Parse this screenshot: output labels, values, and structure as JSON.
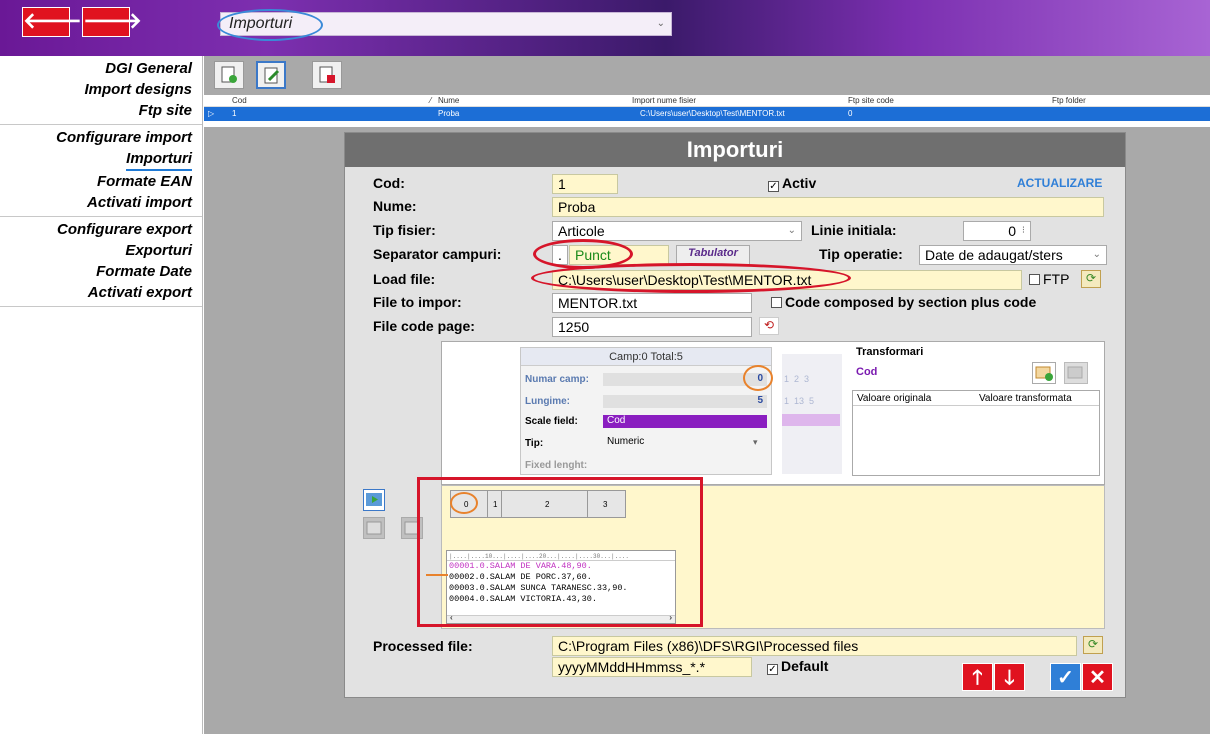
{
  "nav": {
    "back_glyph": "🡐",
    "forward_glyph": "🡒",
    "module_select_value": "Importuri"
  },
  "menu": {
    "groups": [
      [
        "DGI General",
        "Import designs",
        "Ftp site"
      ],
      [
        "Configurare import",
        "Importuri",
        "Formate EAN",
        "Activati import"
      ],
      [
        "Configurare export",
        "Exporturi",
        "Formate Date",
        "Activati export"
      ]
    ]
  },
  "grid": {
    "headers": [
      "Cod",
      "Nume",
      "Import nume fisier",
      "Ftp site code",
      "Ftp folder"
    ],
    "row": {
      "marker": "▷",
      "cod": "1",
      "nume": "Proba",
      "import_file": "C:\\Users\\user\\Desktop\\Test\\MENTOR.txt",
      "ftp_site_code": "0"
    }
  },
  "dialog": {
    "title": "Importuri",
    "cod_label": "Cod:",
    "cod_value": "1",
    "activ_label": "Activ",
    "activ_checked": true,
    "actualizare_link": "ACTUALIZARE",
    "nume_label": "Nume:",
    "nume_value": "Proba",
    "tip_fisier_label": "Tip fisier:",
    "tip_fisier_value": "Articole",
    "linie_initiala_label": "Linie initiala:",
    "linie_initiala_value": "0",
    "separator_label": "Separator campuri:",
    "separator_char": ".",
    "separator_name": "Punct",
    "tabulator_label": "Tabulator",
    "tip_operatie_label": "Tip operatie:",
    "tip_operatie_value": "Date de adaugat/sters",
    "load_file_label": "Load file:",
    "load_file_value": "C:\\Users\\user\\Desktop\\Test\\MENTOR.txt",
    "ftp_label": "FTP",
    "file_to_import_label": "File to impor:",
    "file_to_import_value": "MENTOR.txt",
    "code_composed_label": "Code composed by section plus code",
    "code_page_label": "File code page:",
    "code_page_value": "1250",
    "camp": {
      "header": "Camp:0  Total:5",
      "numar_camp_label": "Numar camp:",
      "numar_camp_value": "0",
      "lungime_label": "Lungime:",
      "lungime_value": "5",
      "scale_field_label": "Scale field:",
      "scale_field_value": "Cod",
      "tip_label": "Tip:",
      "tip_value": "Numeric",
      "fixed_label": "Fixed lenght:",
      "ghost_nums1": "1  2  3",
      "ghost_nums2": "1  13  5"
    },
    "transformari": {
      "title": "Transformari",
      "field": "Cod",
      "col1": "Valoare originala",
      "col2": "Valoare transformata"
    },
    "preview": {
      "columns": [
        "0",
        "1",
        "2",
        "3"
      ],
      "ruler": "|....|....10...|....|....20...|....|....30...|....",
      "lines": [
        "00001.0.SALAM DE VARA.48,90.",
        "00002.0.SALAM DE PORC.37,60.",
        "00003.0.SALAM SUNCA TARANESC.33,90.",
        "00004.0.SALAM VICTORIA.43,30."
      ]
    },
    "processed_label": "Processed file:",
    "processed_value": "C:\\Program Files (x86)\\DFS\\RGI\\Processed files",
    "date_format_value": "yyyyMMddHHmmss_*.*",
    "default_label": "Default",
    "default_checked": true,
    "buttons": {
      "up": "🡑",
      "down": "🡓",
      "ok": "✓",
      "cancel": "✕"
    }
  },
  "colors": {
    "accent": "#1c6ed6",
    "brand": "#6a1896",
    "danger": "#e0121f",
    "field_bg": "#fff7cc"
  }
}
